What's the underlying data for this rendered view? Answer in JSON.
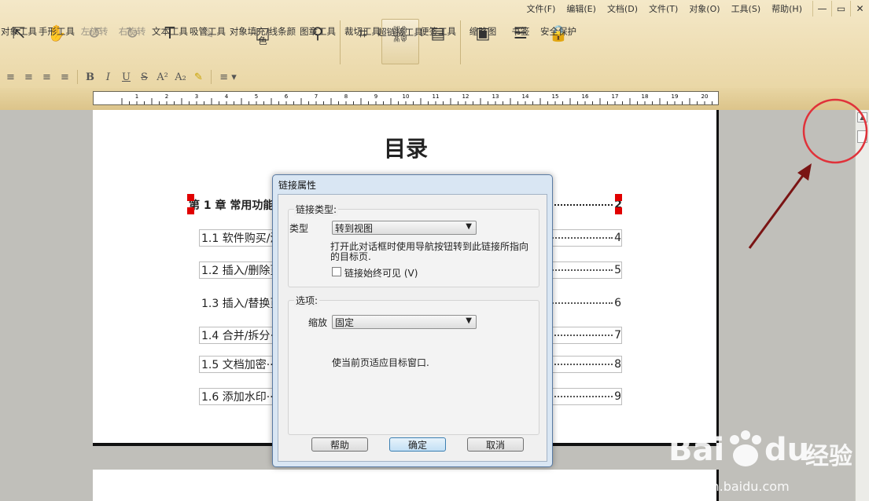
{
  "menu": [
    "文件(F)",
    "编辑(E)",
    "文档(D)",
    "文件(T)",
    "对象(O)",
    "工具(S)",
    "帮助(H)"
  ],
  "window_buttons": {
    "minimize": "—",
    "maximize": "▭",
    "close": "✕"
  },
  "toolbar": [
    {
      "label": "对象工具",
      "icon": "arrow-cursor-icon",
      "glyph": "⇱"
    },
    {
      "label": "手形工具",
      "icon": "hand-icon",
      "glyph": "✋"
    },
    {
      "label": "左旋转",
      "icon": "rotate-left-icon",
      "glyph": "↺"
    },
    {
      "label": "右旋转",
      "icon": "rotate-right-icon",
      "glyph": "↻"
    },
    {
      "label": "文本工具",
      "icon": "text-icon",
      "glyph": "T"
    },
    {
      "label": "吸管工具",
      "icon": "eyedropper-icon",
      "glyph": "✎"
    },
    {
      "label": "对象填充/线条颜\n色",
      "icon": "fill-color-icon",
      "glyph": "□"
    },
    {
      "label": "图章工具",
      "icon": "stamp-icon",
      "glyph": "⚲"
    },
    {
      "label": "裁切工具",
      "icon": "crop-icon",
      "glyph": "⌗"
    },
    {
      "label": "超链接工具",
      "icon": "link-icon",
      "glyph": "⛓"
    },
    {
      "label": "便签工具",
      "icon": "note-icon",
      "glyph": "▤"
    },
    {
      "label": "缩略图",
      "icon": "thumbnail-icon",
      "glyph": "▣"
    },
    {
      "label": "书签",
      "icon": "bookmark-list-icon",
      "glyph": "☰"
    },
    {
      "label": "安全保护",
      "icon": "lock-icon",
      "glyph": "🔒"
    }
  ],
  "format_toolbar": {
    "bold": "B",
    "italic": "I",
    "underline": "U",
    "strike": "S",
    "superscript": "A²",
    "subscript": "A₂",
    "line_style": "≡ ▾"
  },
  "ruler_ticks": [
    "1",
    "2",
    "3",
    "4",
    "5",
    "6",
    "7",
    "8",
    "9",
    "10",
    "11",
    "12",
    "13",
    "14",
    "15",
    "16",
    "17",
    "18",
    "19",
    "20"
  ],
  "document": {
    "title": "目录",
    "entries": [
      {
        "text": "第 1 章  常用功能",
        "page": "2"
      },
      {
        "text": "1.1 软件购买/注",
        "page": "4"
      },
      {
        "text": "1.2 插入/删除页",
        "page": "5"
      },
      {
        "text": "1.3 插入/替换页",
        "page": "6"
      },
      {
        "text": "1.4 合并/拆分",
        "page": "7"
      },
      {
        "text": "1.5 文档加密···",
        "page": "8"
      },
      {
        "text": "1.6 添加水印···",
        "page": "9"
      }
    ]
  },
  "dialog": {
    "title": "链接属性",
    "link_group_label": "链接类型:",
    "type_label": "类型",
    "type_value": "转到视图",
    "type_description": "打开此对话框时使用导航按钮转到此链接所指向的目标页.",
    "always_visible_label": "链接始终可见  (V)",
    "always_visible_checked": false,
    "options_group_label": "选项:",
    "zoom_label": "缩放",
    "zoom_value": "固定",
    "zoom_description": "使当前页适应目标窗口.",
    "buttons": {
      "help": "帮助",
      "ok": "确定",
      "cancel": "取消"
    }
  },
  "watermark": {
    "brand": "Bai",
    "brand2": "du",
    "cn": "经验",
    "url": "jingyan.baidu.com"
  },
  "colors": {
    "toolbar_bg": "#ead7a6",
    "selection_handle": "#e10000",
    "annotation_red": "#e0323a",
    "arrow": "#7a1414"
  }
}
